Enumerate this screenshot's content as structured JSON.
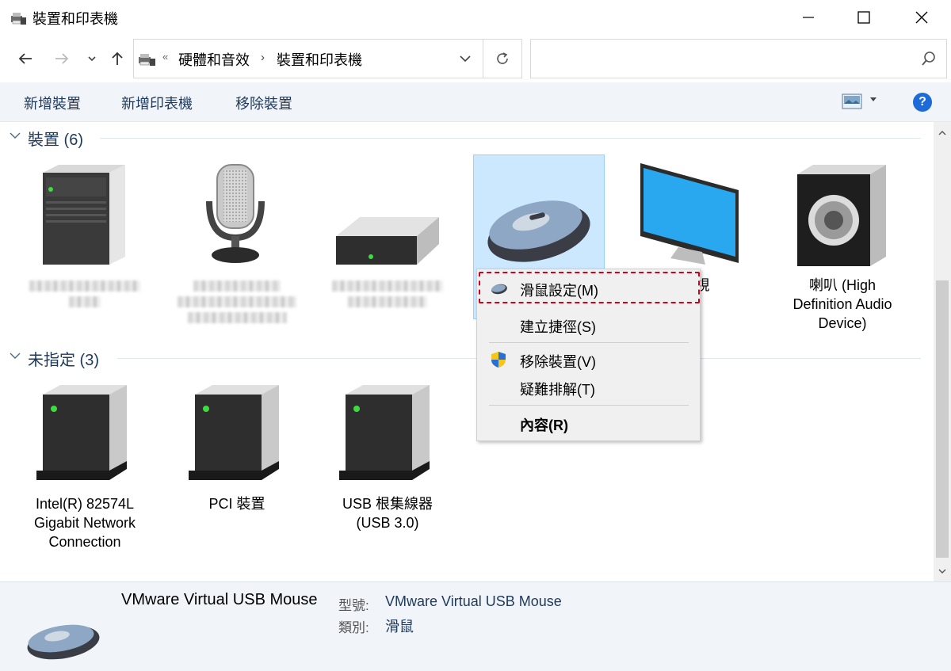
{
  "window": {
    "title": "裝置和印表機",
    "icons": {
      "app": "devices-printers-icon",
      "minimize": "minimize-icon",
      "maximize": "maximize-icon",
      "close": "close-icon"
    }
  },
  "nav": {
    "icons": [
      "back-arrow-icon",
      "forward-arrow-icon",
      "recent-dropdown-icon",
      "up-arrow-icon"
    ],
    "breadcrumb_prefix": "«",
    "breadcrumb": [
      "硬體和音效",
      "裝置和印表機"
    ],
    "breadcrumb_separator": "›",
    "search_placeholder": ""
  },
  "commands": {
    "add_device": "新增裝置",
    "add_printer": "新增印表機",
    "remove_device": "移除裝置",
    "help": "?"
  },
  "groups": {
    "devices": {
      "label": "裝置 (6)",
      "items": [
        {
          "label": "",
          "icon": "computer-tower-icon",
          "blurred": true
        },
        {
          "label": "",
          "icon": "microphone-icon",
          "blurred": true
        },
        {
          "label": "",
          "icon": "external-drive-icon",
          "blurred": true
        },
        {
          "label": "",
          "icon": "mouse-icon",
          "selected": true
        },
        {
          "label": "P 監視",
          "icon": "monitor-icon"
        },
        {
          "label": "喇叭 (High Definition Audio Device)",
          "icon": "speaker-icon"
        }
      ]
    },
    "unspecified": {
      "label": "未指定 (3)",
      "items": [
        {
          "label": "Intel(R) 82574L Gigabit Network Connection",
          "icon": "generic-device-icon"
        },
        {
          "label": "PCI 裝置",
          "icon": "generic-device-icon"
        },
        {
          "label": "USB 根集線器 (USB 3.0)",
          "icon": "generic-device-icon"
        }
      ]
    }
  },
  "context_menu": {
    "items": [
      {
        "label": "滑鼠設定(M)",
        "icon": "mouse-small-icon",
        "highlighted": true
      },
      {
        "label": "建立捷徑(S)"
      },
      {
        "label": "移除裝置(V)",
        "icon": "uac-shield-icon"
      },
      {
        "label": "疑難排解(T)"
      },
      {
        "label": "內容(R)",
        "bold": true
      }
    ]
  },
  "details": {
    "name": "VMware Virtual USB Mouse",
    "model_key": "型號:",
    "model_value": "VMware Virtual USB Mouse",
    "category_key": "類別:",
    "category_value": "滑鼠"
  },
  "colors": {
    "accent": "#1e395b",
    "selection": "#cce8ff",
    "highlight_border": "#d0021b",
    "help_blue": "#1c6bd8"
  }
}
